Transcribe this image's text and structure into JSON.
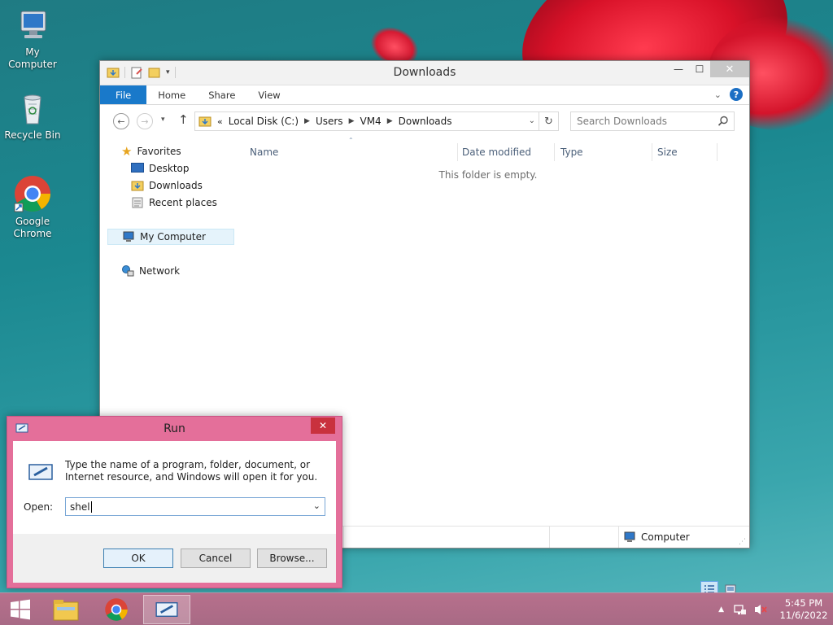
{
  "desktop": {
    "icons": [
      {
        "label": "My Computer"
      },
      {
        "label": "Recycle Bin"
      },
      {
        "label": "Google Chrome"
      }
    ]
  },
  "explorer": {
    "title": "Downloads",
    "ribbon_tabs": [
      "File",
      "Home",
      "Share",
      "View"
    ],
    "address": {
      "prefix": "«",
      "segments": [
        "Local Disk (C:)",
        "Users",
        "VM4",
        "Downloads"
      ]
    },
    "search_placeholder": "Search Downloads",
    "nav": {
      "favorites": "Favorites",
      "desktop": "Desktop",
      "downloads": "Downloads",
      "recent": "Recent places",
      "computer": "My Computer",
      "network": "Network"
    },
    "columns": [
      "Name",
      "Date modified",
      "Type",
      "Size"
    ],
    "empty_message": "This folder is empty.",
    "status_location": "Computer"
  },
  "run": {
    "title": "Run",
    "description": "Type the name of a program, folder, document, or Internet resource, and Windows will open it for you.",
    "open_label": "Open:",
    "input_value": "shel",
    "ok": "OK",
    "cancel": "Cancel",
    "browse": "Browse..."
  },
  "taskbar": {
    "time": "5:45 PM",
    "date": "11/6/2022"
  },
  "colors": {
    "accent": "#1979ca",
    "run_frame": "#e46f9a",
    "taskbar": "#b7708c"
  }
}
